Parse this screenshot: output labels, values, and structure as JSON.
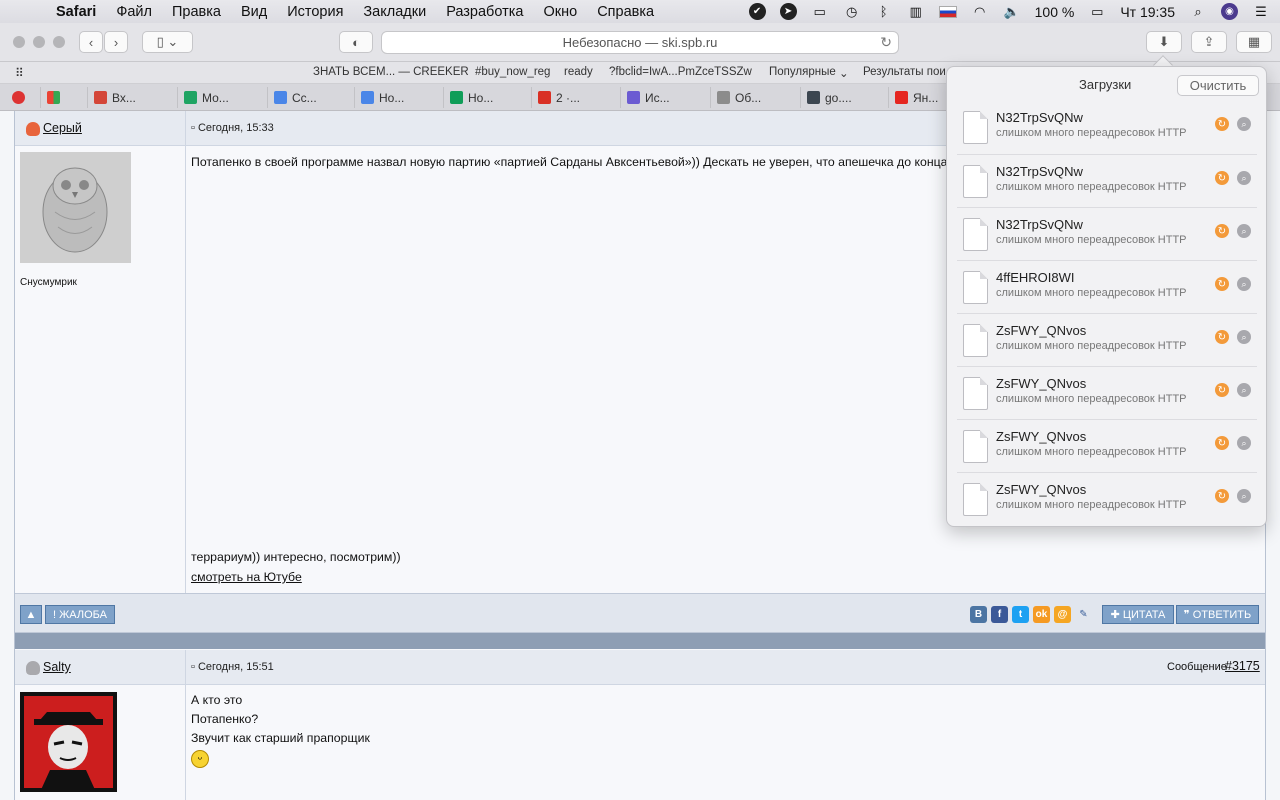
{
  "menubar": {
    "app": "Safari",
    "items": [
      "Файл",
      "Правка",
      "Вид",
      "История",
      "Закладки",
      "Разработка",
      "Окно",
      "Справка"
    ],
    "battery": "100 %",
    "clock": "Чт 19:35"
  },
  "toolbar": {
    "address": "Небезопасно — ski.spb.ru"
  },
  "favorites": [
    "ЗНАТЬ ВСЕМ... — CREEKER",
    "#buy_now_reg",
    "ready",
    "?fbclid=IwA...PmZceTSSZw",
    "Популярные",
    "Результаты пои"
  ],
  "tabs": [
    {
      "label": "Вх...",
      "color": "#d44638"
    },
    {
      "label": "Мо...",
      "color": "#1fa463"
    },
    {
      "label": "Сс...",
      "color": "#4a86e8"
    },
    {
      "label": "Но...",
      "color": "#4a86e8"
    },
    {
      "label": "Но...",
      "color": "#0f9d58"
    },
    {
      "label": "2 ·...",
      "color": "#d93025"
    },
    {
      "label": "Ис...",
      "color": "#6b5bd2"
    },
    {
      "label": "Об...",
      "color": "#8c8c8c"
    },
    {
      "label": "go....",
      "color": "#3c4650"
    },
    {
      "label": "Ян...",
      "color": "#e52620"
    }
  ],
  "post1": {
    "author": "Серый",
    "date": "Сегодня, 15:33",
    "user_title": "Снусмумрик",
    "text": "Потапенко в своей программе назвал новую партию «партией Сарданы Авксентьевой»)) Дескать не уверен, что апешечка до конца отд",
    "text_tail": "террариум)) интересно, посмотрим))",
    "youtube_link": "смотреть на Ютубе",
    "complaint_btn": "ЖАЛОБА",
    "quote_btn": "ЦИТАТА",
    "reply_btn": "ОТВЕТИТЬ"
  },
  "post2": {
    "author": "Salty",
    "date": "Сегодня, 15:51",
    "message_label": "Сообщение",
    "message_num": "#3175",
    "lines": [
      "А кто это",
      "Потапенко?",
      "Звучит как старший прапорщик"
    ]
  },
  "downloads": {
    "title": "Загрузки",
    "clear_btn": "Очистить",
    "items": [
      {
        "name": "N32TrpSvQNw",
        "status": "слишком много переадресовок HTTP"
      },
      {
        "name": "N32TrpSvQNw",
        "status": "слишком много переадресовок HTTP"
      },
      {
        "name": "N32TrpSvQNw",
        "status": "слишком много переадресовок HTTP"
      },
      {
        "name": "4ffEHROI8WI",
        "status": "слишком много переадресовок HTTP"
      },
      {
        "name": "ZsFWY_QNvos",
        "status": "слишком много переадресовок HTTP"
      },
      {
        "name": "ZsFWY_QNvos",
        "status": "слишком много переадресовок HTTP"
      },
      {
        "name": "ZsFWY_QNvos",
        "status": "слишком много переадресовок HTTP"
      },
      {
        "name": "ZsFWY_QNvos",
        "status": "слишком много переадресовок HTTP"
      }
    ]
  },
  "social": [
    {
      "label": "B",
      "color": "#4c75a3"
    },
    {
      "label": "f",
      "color": "#3b5998"
    },
    {
      "label": "t",
      "color": "#1da1f2"
    },
    {
      "label": "ok",
      "color": "#f59a23"
    },
    {
      "label": "@",
      "color": "#f5a623"
    }
  ]
}
